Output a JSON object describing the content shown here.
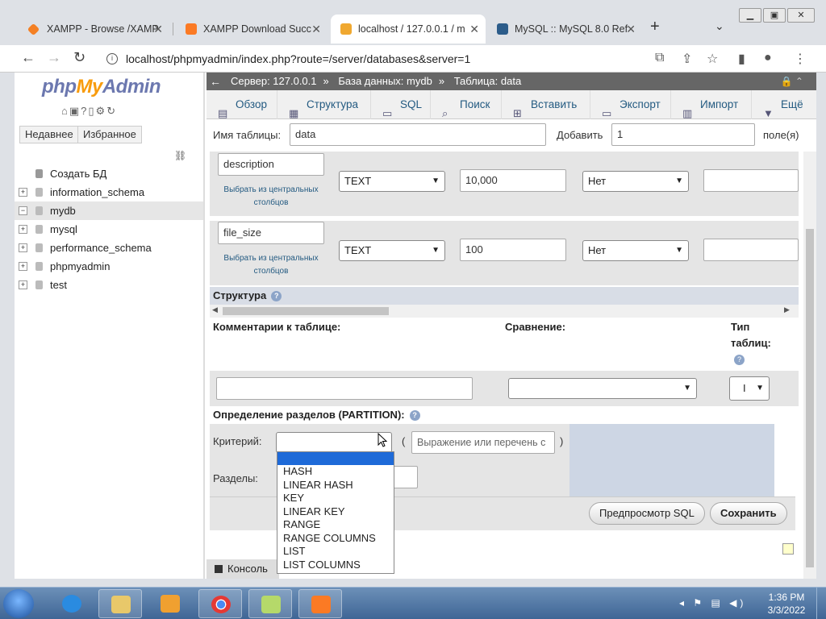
{
  "browser": {
    "tabs": [
      {
        "label": "XAMPP - Browse /XAMP",
        "icon": "xampp-icon",
        "active": false
      },
      {
        "label": "XAMPP Download Succ",
        "icon": "xampp-orange-icon",
        "active": false
      },
      {
        "label": "localhost / 127.0.0.1 / m",
        "icon": "pma-icon",
        "active": true
      },
      {
        "label": "MySQL :: MySQL 8.0 Ref",
        "icon": "mysql-icon",
        "active": false
      }
    ],
    "new_tab": "+",
    "tab_close": "✕",
    "url": "localhost/phpmyadmin/index.php?route=/server/databases&server=1"
  },
  "sidebar": {
    "logo_php": "php",
    "logo_my": "My",
    "logo_admin": "Admin",
    "recent_label": "Недавнее",
    "favorites_label": "Избранное",
    "tree": [
      {
        "label": "Создать БД",
        "type": "new",
        "selected": false
      },
      {
        "label": "information_schema",
        "type": "db",
        "selected": false
      },
      {
        "label": "mydb",
        "type": "db",
        "selected": true
      },
      {
        "label": "mysql",
        "type": "db",
        "selected": false
      },
      {
        "label": "performance_schema",
        "type": "db",
        "selected": false
      },
      {
        "label": "phpmyadmin",
        "type": "db",
        "selected": false
      },
      {
        "label": "test",
        "type": "db",
        "selected": false
      }
    ]
  },
  "breadcrumb": {
    "server": "Сервер: 127.0.0.1",
    "database": "База данных: mydb",
    "table": "Таблица: data"
  },
  "menu": [
    {
      "label": "Обзор",
      "icon": "browse-icon"
    },
    {
      "label": "Структура",
      "icon": "structure-icon"
    },
    {
      "label": "SQL",
      "icon": "sql-icon"
    },
    {
      "label": "Поиск",
      "icon": "search-icon"
    },
    {
      "label": "Вставить",
      "icon": "insert-icon"
    },
    {
      "label": "Экспорт",
      "icon": "export-icon"
    },
    {
      "label": "Импорт",
      "icon": "import-icon"
    },
    {
      "label": "Ещё",
      "icon": "chevron-down-icon"
    }
  ],
  "table_form": {
    "table_name_label": "Имя таблицы:",
    "table_name_value": "data",
    "add_label": "Добавить",
    "add_value": "1",
    "fields_label": "поле(я)"
  },
  "fields": [
    {
      "name": "description",
      "central_link": "Выбрать из центральных столбцов",
      "type": "TEXT",
      "length": "10,000",
      "default": "Нет"
    },
    {
      "name": "file_size",
      "central_link": "Выбрать из центральных столбцов",
      "type": "TEXT",
      "length": "100",
      "default": "Нет"
    }
  ],
  "structure_label": "Структура",
  "options": {
    "comments_label": "Комментарии к таблице:",
    "collation_label": "Сравнение:",
    "engine_label": "Тип таблиц:",
    "engine_value": "I"
  },
  "partition": {
    "header": "Определение разделов (PARTITION):",
    "criteria_label": "Критерий:",
    "expression_placeholder": "Выражение или перечень с",
    "partitions_label": "Разделы:",
    "open_paren": "(",
    "close_paren": ")",
    "dropdown_options": [
      "",
      "HASH",
      "LINEAR HASH",
      "KEY",
      "LINEAR KEY",
      "RANGE",
      "RANGE COLUMNS",
      "LIST",
      "LIST COLUMNS"
    ]
  },
  "buttons": {
    "preview_sql": "Предпросмотр SQL",
    "save": "Сохранить"
  },
  "console_label": "Консоль",
  "taskbar": {
    "time": "1:36 PM",
    "date": "3/3/2022"
  },
  "colors": {
    "accent": "#235a81",
    "breadcrumb_bg": "#666666",
    "dropdown_highlight": "#1e6ad8"
  }
}
